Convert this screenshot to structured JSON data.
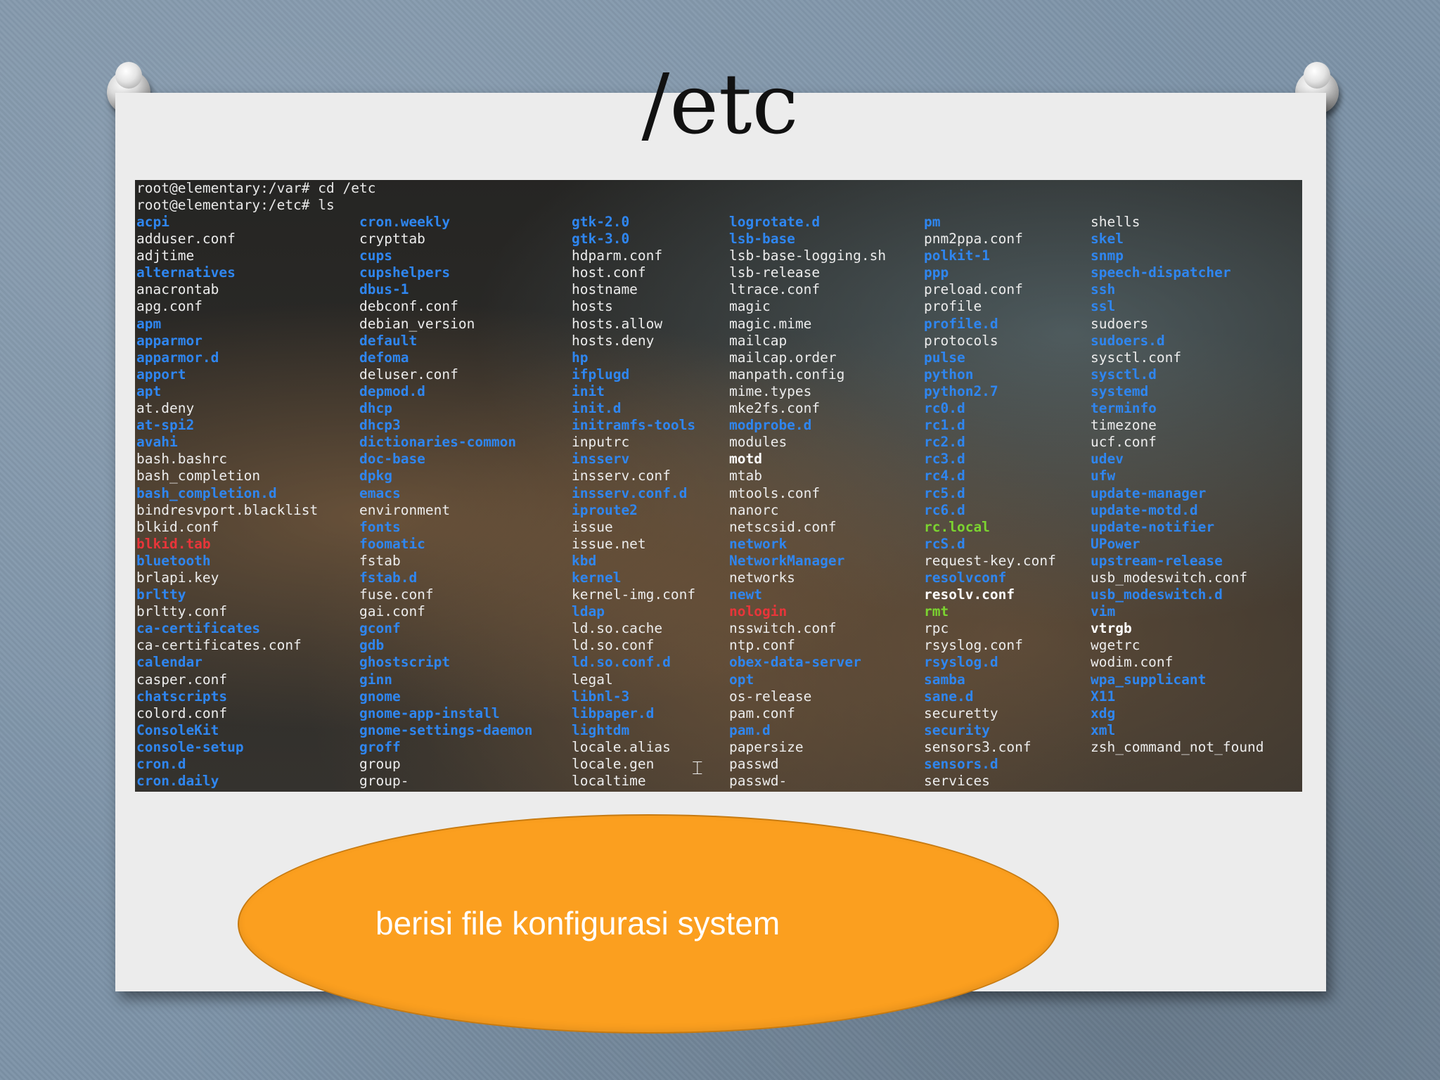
{
  "slide": {
    "title": "/etc",
    "caption": "berisi file konfigurasi system"
  },
  "colors": {
    "background": "#7d93a8",
    "card": "#ececec",
    "terminal_directory": "#2f86f0",
    "terminal_file": "#ececec",
    "terminal_broken_link": "#e8353a",
    "terminal_executable": "#7bd430",
    "oval_fill": "#fb9f1f"
  },
  "terminal": {
    "line1": "root@elementary:/var# cd /etc",
    "line2": "root@elementary:/etc# ls",
    "cursor_icon": "i-beam-cursor-icon",
    "columns": [
      [
        {
          "name": "acpi",
          "type": "dir"
        },
        {
          "name": "adduser.conf",
          "type": "file"
        },
        {
          "name": "adjtime",
          "type": "file"
        },
        {
          "name": "alternatives",
          "type": "dir"
        },
        {
          "name": "anacrontab",
          "type": "file"
        },
        {
          "name": "apg.conf",
          "type": "file"
        },
        {
          "name": "apm",
          "type": "dir"
        },
        {
          "name": "apparmor",
          "type": "dir"
        },
        {
          "name": "apparmor.d",
          "type": "dir"
        },
        {
          "name": "apport",
          "type": "dir"
        },
        {
          "name": "apt",
          "type": "dir"
        },
        {
          "name": "at.deny",
          "type": "file"
        },
        {
          "name": "at-spi2",
          "type": "dir"
        },
        {
          "name": "avahi",
          "type": "dir"
        },
        {
          "name": "bash.bashrc",
          "type": "file"
        },
        {
          "name": "bash_completion",
          "type": "file"
        },
        {
          "name": "bash_completion.d",
          "type": "dir"
        },
        {
          "name": "bindresvport.blacklist",
          "type": "file"
        },
        {
          "name": "blkid.conf",
          "type": "file"
        },
        {
          "name": "blkid.tab",
          "type": "broken"
        },
        {
          "name": "bluetooth",
          "type": "dir"
        },
        {
          "name": "brlapi.key",
          "type": "file"
        },
        {
          "name": "brltty",
          "type": "dir"
        },
        {
          "name": "brltty.conf",
          "type": "file"
        },
        {
          "name": "ca-certificates",
          "type": "dir"
        },
        {
          "name": "ca-certificates.conf",
          "type": "file"
        },
        {
          "name": "calendar",
          "type": "dir"
        },
        {
          "name": "casper.conf",
          "type": "file"
        },
        {
          "name": "chatscripts",
          "type": "dir"
        },
        {
          "name": "colord.conf",
          "type": "file"
        },
        {
          "name": "ConsoleKit",
          "type": "dir"
        },
        {
          "name": "console-setup",
          "type": "dir"
        },
        {
          "name": "cron.d",
          "type": "dir"
        },
        {
          "name": "cron.daily",
          "type": "dir"
        }
      ],
      [
        {
          "name": "cron.weekly",
          "type": "dir"
        },
        {
          "name": "crypttab",
          "type": "file"
        },
        {
          "name": "cups",
          "type": "dir"
        },
        {
          "name": "cupshelpers",
          "type": "dir"
        },
        {
          "name": "dbus-1",
          "type": "dir"
        },
        {
          "name": "debconf.conf",
          "type": "file"
        },
        {
          "name": "debian_version",
          "type": "file"
        },
        {
          "name": "default",
          "type": "dir"
        },
        {
          "name": "defoma",
          "type": "dir"
        },
        {
          "name": "deluser.conf",
          "type": "file"
        },
        {
          "name": "depmod.d",
          "type": "dir"
        },
        {
          "name": "dhcp",
          "type": "dir"
        },
        {
          "name": "dhcp3",
          "type": "dir"
        },
        {
          "name": "dictionaries-common",
          "type": "dir"
        },
        {
          "name": "doc-base",
          "type": "dir"
        },
        {
          "name": "dpkg",
          "type": "dir"
        },
        {
          "name": "emacs",
          "type": "dir"
        },
        {
          "name": "environment",
          "type": "file"
        },
        {
          "name": "fonts",
          "type": "dir"
        },
        {
          "name": "foomatic",
          "type": "dir"
        },
        {
          "name": "fstab",
          "type": "file"
        },
        {
          "name": "fstab.d",
          "type": "dir"
        },
        {
          "name": "fuse.conf",
          "type": "file"
        },
        {
          "name": "gai.conf",
          "type": "file"
        },
        {
          "name": "gconf",
          "type": "dir"
        },
        {
          "name": "gdb",
          "type": "dir"
        },
        {
          "name": "ghostscript",
          "type": "dir"
        },
        {
          "name": "ginn",
          "type": "dir"
        },
        {
          "name": "gnome",
          "type": "dir"
        },
        {
          "name": "gnome-app-install",
          "type": "dir"
        },
        {
          "name": "gnome-settings-daemon",
          "type": "dir"
        },
        {
          "name": "groff",
          "type": "dir"
        },
        {
          "name": "group",
          "type": "file"
        },
        {
          "name": "group-",
          "type": "file"
        }
      ],
      [
        {
          "name": "gtk-2.0",
          "type": "dir"
        },
        {
          "name": "gtk-3.0",
          "type": "dir"
        },
        {
          "name": "hdparm.conf",
          "type": "file"
        },
        {
          "name": "host.conf",
          "type": "file"
        },
        {
          "name": "hostname",
          "type": "file"
        },
        {
          "name": "hosts",
          "type": "file"
        },
        {
          "name": "hosts.allow",
          "type": "file"
        },
        {
          "name": "hosts.deny",
          "type": "file"
        },
        {
          "name": "hp",
          "type": "dir"
        },
        {
          "name": "ifplugd",
          "type": "dir"
        },
        {
          "name": "init",
          "type": "dir"
        },
        {
          "name": "init.d",
          "type": "dir"
        },
        {
          "name": "initramfs-tools",
          "type": "dir"
        },
        {
          "name": "inputrc",
          "type": "file"
        },
        {
          "name": "insserv",
          "type": "dir"
        },
        {
          "name": "insserv.conf",
          "type": "file"
        },
        {
          "name": "insserv.conf.d",
          "type": "dir"
        },
        {
          "name": "iproute2",
          "type": "dir"
        },
        {
          "name": "issue",
          "type": "file"
        },
        {
          "name": "issue.net",
          "type": "file"
        },
        {
          "name": "kbd",
          "type": "dir"
        },
        {
          "name": "kernel",
          "type": "dir"
        },
        {
          "name": "kernel-img.conf",
          "type": "file"
        },
        {
          "name": "ldap",
          "type": "dir"
        },
        {
          "name": "ld.so.cache",
          "type": "file"
        },
        {
          "name": "ld.so.conf",
          "type": "file"
        },
        {
          "name": "ld.so.conf.d",
          "type": "dir"
        },
        {
          "name": "legal",
          "type": "file"
        },
        {
          "name": "libnl-3",
          "type": "dir"
        },
        {
          "name": "libpaper.d",
          "type": "dir"
        },
        {
          "name": "lightdm",
          "type": "dir"
        },
        {
          "name": "locale.alias",
          "type": "file"
        },
        {
          "name": "locale.gen",
          "type": "file"
        },
        {
          "name": "localtime",
          "type": "file"
        }
      ],
      [
        {
          "name": "logrotate.d",
          "type": "dir"
        },
        {
          "name": "lsb-base",
          "type": "dir"
        },
        {
          "name": "lsb-base-logging.sh",
          "type": "file"
        },
        {
          "name": "lsb-release",
          "type": "file"
        },
        {
          "name": "ltrace.conf",
          "type": "file"
        },
        {
          "name": "magic",
          "type": "file"
        },
        {
          "name": "magic.mime",
          "type": "file"
        },
        {
          "name": "mailcap",
          "type": "file"
        },
        {
          "name": "mailcap.order",
          "type": "file"
        },
        {
          "name": "manpath.config",
          "type": "file"
        },
        {
          "name": "mime.types",
          "type": "file"
        },
        {
          "name": "mke2fs.conf",
          "type": "file"
        },
        {
          "name": "modprobe.d",
          "type": "dir"
        },
        {
          "name": "modules",
          "type": "file"
        },
        {
          "name": "motd",
          "type": "dir-white"
        },
        {
          "name": "mtab",
          "type": "file"
        },
        {
          "name": "mtools.conf",
          "type": "file"
        },
        {
          "name": "nanorc",
          "type": "file"
        },
        {
          "name": "netscsid.conf",
          "type": "file"
        },
        {
          "name": "network",
          "type": "dir"
        },
        {
          "name": "NetworkManager",
          "type": "dir"
        },
        {
          "name": "networks",
          "type": "file"
        },
        {
          "name": "newt",
          "type": "dir"
        },
        {
          "name": "nologin",
          "type": "broken"
        },
        {
          "name": "nsswitch.conf",
          "type": "file"
        },
        {
          "name": "ntp.conf",
          "type": "file"
        },
        {
          "name": "obex-data-server",
          "type": "dir"
        },
        {
          "name": "opt",
          "type": "dir"
        },
        {
          "name": "os-release",
          "type": "file"
        },
        {
          "name": "pam.conf",
          "type": "file"
        },
        {
          "name": "pam.d",
          "type": "dir"
        },
        {
          "name": "papersize",
          "type": "file"
        },
        {
          "name": "passwd",
          "type": "file"
        },
        {
          "name": "passwd-",
          "type": "file"
        }
      ],
      [
        {
          "name": "pm",
          "type": "dir"
        },
        {
          "name": "pnm2ppa.conf",
          "type": "file"
        },
        {
          "name": "polkit-1",
          "type": "dir"
        },
        {
          "name": "ppp",
          "type": "dir"
        },
        {
          "name": "preload.conf",
          "type": "file"
        },
        {
          "name": "profile",
          "type": "file"
        },
        {
          "name": "profile.d",
          "type": "dir"
        },
        {
          "name": "protocols",
          "type": "file"
        },
        {
          "name": "pulse",
          "type": "dir"
        },
        {
          "name": "python",
          "type": "dir"
        },
        {
          "name": "python2.7",
          "type": "dir"
        },
        {
          "name": "rc0.d",
          "type": "dir"
        },
        {
          "name": "rc1.d",
          "type": "dir"
        },
        {
          "name": "rc2.d",
          "type": "dir"
        },
        {
          "name": "rc3.d",
          "type": "dir"
        },
        {
          "name": "rc4.d",
          "type": "dir"
        },
        {
          "name": "rc5.d",
          "type": "dir"
        },
        {
          "name": "rc6.d",
          "type": "dir"
        },
        {
          "name": "rc.local",
          "type": "exe"
        },
        {
          "name": "rcS.d",
          "type": "dir"
        },
        {
          "name": "request-key.conf",
          "type": "file"
        },
        {
          "name": "resolvconf",
          "type": "dir"
        },
        {
          "name": "resolv.conf",
          "type": "dir-white"
        },
        {
          "name": "rmt",
          "type": "exe"
        },
        {
          "name": "rpc",
          "type": "file"
        },
        {
          "name": "rsyslog.conf",
          "type": "file"
        },
        {
          "name": "rsyslog.d",
          "type": "dir"
        },
        {
          "name": "samba",
          "type": "dir"
        },
        {
          "name": "sane.d",
          "type": "dir"
        },
        {
          "name": "securetty",
          "type": "file"
        },
        {
          "name": "security",
          "type": "dir"
        },
        {
          "name": "sensors3.conf",
          "type": "file"
        },
        {
          "name": "sensors.d",
          "type": "dir"
        },
        {
          "name": "services",
          "type": "file"
        }
      ],
      [
        {
          "name": "shells",
          "type": "file"
        },
        {
          "name": "skel",
          "type": "dir"
        },
        {
          "name": "snmp",
          "type": "dir"
        },
        {
          "name": "speech-dispatcher",
          "type": "dir"
        },
        {
          "name": "ssh",
          "type": "dir"
        },
        {
          "name": "ssl",
          "type": "dir"
        },
        {
          "name": "sudoers",
          "type": "file"
        },
        {
          "name": "sudoers.d",
          "type": "dir"
        },
        {
          "name": "sysctl.conf",
          "type": "file"
        },
        {
          "name": "sysctl.d",
          "type": "dir"
        },
        {
          "name": "systemd",
          "type": "dir"
        },
        {
          "name": "terminfo",
          "type": "dir"
        },
        {
          "name": "timezone",
          "type": "file"
        },
        {
          "name": "ucf.conf",
          "type": "file"
        },
        {
          "name": "udev",
          "type": "dir"
        },
        {
          "name": "ufw",
          "type": "dir"
        },
        {
          "name": "update-manager",
          "type": "dir"
        },
        {
          "name": "update-motd.d",
          "type": "dir"
        },
        {
          "name": "update-notifier",
          "type": "dir"
        },
        {
          "name": "UPower",
          "type": "dir"
        },
        {
          "name": "upstream-release",
          "type": "dir"
        },
        {
          "name": "usb_modeswitch.conf",
          "type": "file"
        },
        {
          "name": "usb_modeswitch.d",
          "type": "dir"
        },
        {
          "name": "vim",
          "type": "dir"
        },
        {
          "name": "vtrgb",
          "type": "dir-white"
        },
        {
          "name": "wgetrc",
          "type": "file"
        },
        {
          "name": "wodim.conf",
          "type": "file"
        },
        {
          "name": "wpa_supplicant",
          "type": "dir"
        },
        {
          "name": "X11",
          "type": "dir"
        },
        {
          "name": "xdg",
          "type": "dir"
        },
        {
          "name": "xml",
          "type": "dir"
        },
        {
          "name": "zsh_command_not_found",
          "type": "file"
        }
      ]
    ]
  }
}
